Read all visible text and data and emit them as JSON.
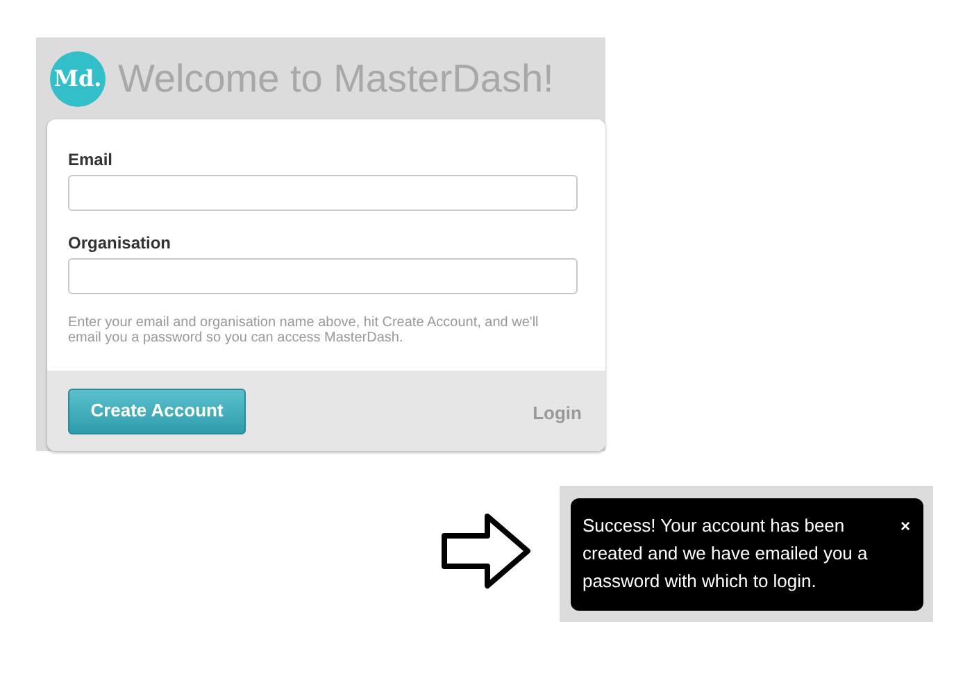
{
  "header": {
    "logo": "Md.",
    "title": "Welcome to MasterDash!"
  },
  "form": {
    "fields": [
      {
        "label": "Email"
      },
      {
        "label": "Organisation"
      }
    ],
    "help": "Enter your email and organisation name above, hit Create Account, and we'll email you a password so you can access MasterDash.",
    "submit": "Create Account",
    "login_link": "Login"
  },
  "notification": {
    "message": "Success! Your account has been created and we have emailed you a password with which to login.",
    "close": "×"
  }
}
